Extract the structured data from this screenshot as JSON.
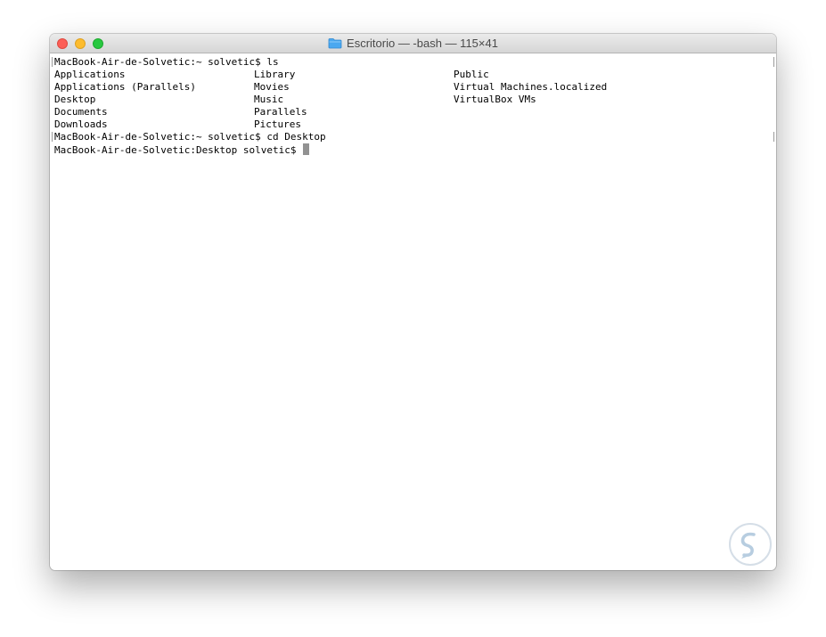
{
  "window": {
    "title": "Escritorio — -bash — 115×41",
    "title_icon": "folder-icon"
  },
  "terminal": {
    "lines": [
      {
        "type": "prompt",
        "text": "MacBook-Air-de-Solvetic:~ solvetic$ ls"
      },
      {
        "type": "cols",
        "cols": [
          "Applications",
          "Library",
          "Public"
        ]
      },
      {
        "type": "cols",
        "cols": [
          "Applications (Parallels)",
          "Movies",
          "Virtual Machines.localized"
        ]
      },
      {
        "type": "cols",
        "cols": [
          "Desktop",
          "Music",
          "VirtualBox VMs"
        ]
      },
      {
        "type": "cols",
        "cols": [
          "Documents",
          "Parallels",
          ""
        ]
      },
      {
        "type": "cols",
        "cols": [
          "Downloads",
          "Pictures",
          ""
        ]
      },
      {
        "type": "prompt",
        "text": "MacBook-Air-de-Solvetic:~ solvetic$ cd Desktop"
      },
      {
        "type": "current",
        "text": "MacBook-Air-de-Solvetic:Desktop solvetic$ "
      }
    ]
  },
  "colors": {
    "close": "#fc5f57",
    "minimize": "#fdbc2e",
    "zoom": "#28c840",
    "folder": "#4aa8f0",
    "cursor": "#929292",
    "watermark": "#b7cde0"
  },
  "watermark": {
    "icon": "solvetic-logo-icon"
  }
}
